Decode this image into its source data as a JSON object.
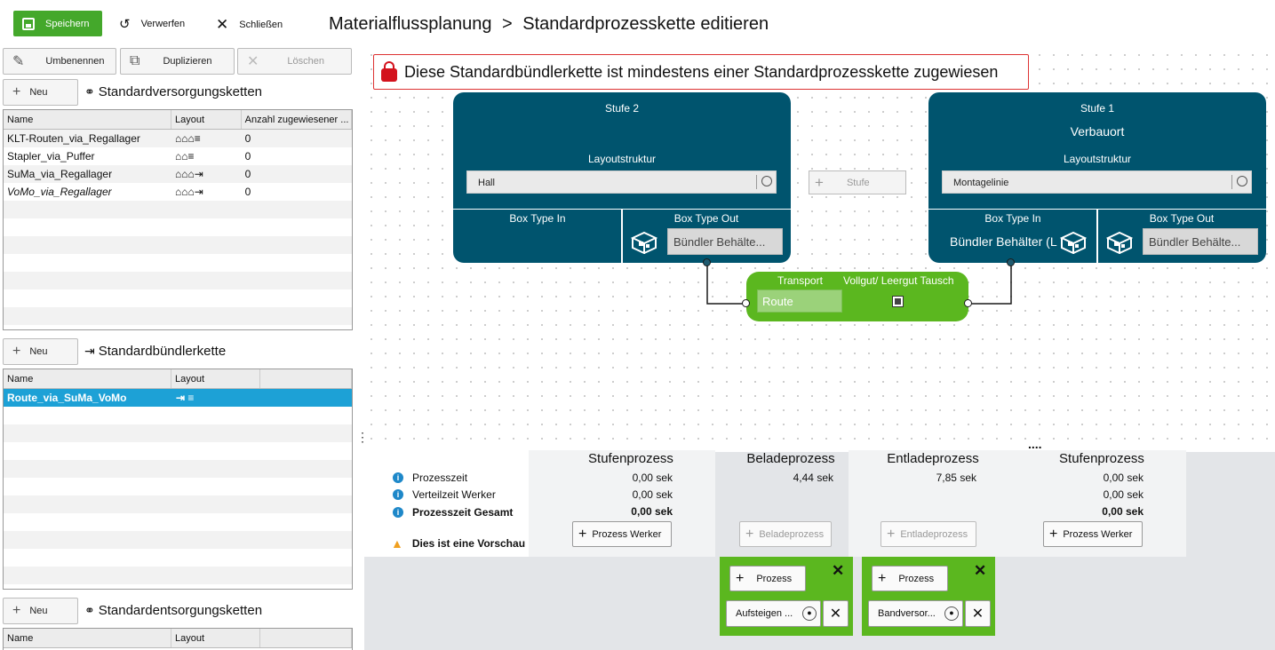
{
  "toolbar": {
    "save_label": "Speichern",
    "discard_label": "Verwerfen",
    "close_label": "Schließen"
  },
  "breadcrumb": {
    "root": "Materialflussplanung",
    "separator": ">",
    "page": "Standardprozesskette editieren"
  },
  "left": {
    "rename_label": "Umbenennen",
    "duplicate_label": "Duplizieren",
    "delete_label": "Löschen",
    "supply": {
      "new_label": "Neu",
      "title": "Standardversorgungsketten",
      "columns": [
        "Name",
        "Layout",
        "Anzahl zugewiesener ..."
      ],
      "rows": [
        {
          "name": "KLT-Routen_via_Regallager",
          "layout": "⌂⌂⌂≡",
          "count": "0"
        },
        {
          "name": "Stapler_via_Puffer",
          "layout": "⌂⌂≡",
          "count": "0"
        },
        {
          "name": "SuMa_via_Regallager",
          "layout": "⌂⌂⌂⇥",
          "count": "0"
        },
        {
          "name": "VoMo_via_Regallager",
          "layout": "⌂⌂⌂⇥",
          "count": "0"
        }
      ]
    },
    "bundler": {
      "new_label": "Neu",
      "title": "Standardbündlerkette",
      "columns": [
        "Name",
        "Layout"
      ],
      "rows": [
        {
          "name": "Route_via_SuMa_VoMo",
          "layout": "⇥ ≡"
        }
      ]
    },
    "disposal": {
      "new_label": "Neu",
      "title": "Standardentsorgungsketten",
      "columns": [
        "Name",
        "Layout"
      ]
    }
  },
  "canvas": {
    "warning": "Diese Standardbündlerkette ist mindestens einer Standardprozesskette zugewiesen",
    "stage2": {
      "title": "Stufe 2",
      "subtitle": "",
      "layout_label": "Layoutstruktur",
      "layout_value": "Hall",
      "box_in_label": "Box Type In",
      "box_out_label": "Box Type Out",
      "box_out_value": "Bündler Behälte..."
    },
    "stage1": {
      "title": "Stufe 1",
      "subtitle": "Verbauort",
      "layout_label": "Layoutstruktur",
      "layout_value": "Montagelinie",
      "box_in_label": "Box Type In",
      "box_in_value": "Bündler Behälter (L",
      "box_out_label": "Box Type Out",
      "box_out_value": "Bündler Behälte..."
    },
    "add_stage_label": "Stufe",
    "transport": {
      "label": "Transport",
      "value": "Route",
      "swap_label": "Vollgut/ Leergut Tausch"
    }
  },
  "summary": {
    "labels": {
      "process_time": "Prozesszeit",
      "distribution_time": "Verteilzeit Werker",
      "total": "Prozesszeit Gesamt",
      "preview": "Dies ist eine Vorschau"
    },
    "more": "....",
    "columns": [
      {
        "title": "Stufenprozess",
        "pt": "0,00 sek",
        "dt": "0,00 sek",
        "tot": "0,00 sek",
        "btn": "Prozess Werker"
      },
      {
        "title": "Beladeprozess",
        "pt": "4,44 sek",
        "btn": "Beladeprozess"
      },
      {
        "title": "Entladeprozess",
        "pt": "7,85 sek",
        "btn": "Entladeprozess"
      },
      {
        "title": "Stufenprozess",
        "pt": "0,00 sek",
        "dt": "0,00 sek",
        "tot": "0,00 sek",
        "btn": "Prozess Werker"
      }
    ],
    "load_box": {
      "add_label": "Prozess",
      "item": "Aufsteigen ..."
    },
    "unload_box": {
      "add_label": "Prozess",
      "item": "Bandversor..."
    }
  }
}
